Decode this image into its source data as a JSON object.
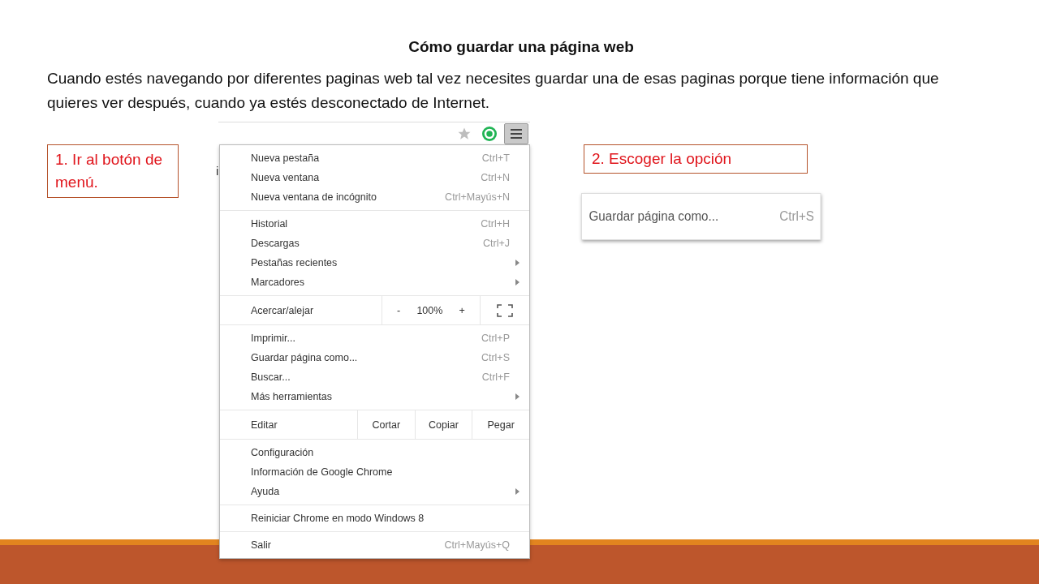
{
  "slide": {
    "title": "Cómo guardar una página web",
    "intro": "Cuando estés navegando por diferentes paginas web tal vez necesites guardar una de esas paginas porque tiene información que quieres ver después, cuando ya estés desconectado de Internet.",
    "step_1": "1. Ir al botón de menú.",
    "step_2": "2. Escoger la opción"
  },
  "browser_screenshot": {
    "page_fragment": "i",
    "sections": [
      {
        "kind": "items",
        "items": [
          {
            "label": "Nueva pestaña",
            "shortcut": "Ctrl+T",
            "submenu": false
          },
          {
            "label": "Nueva ventana",
            "shortcut": "Ctrl+N",
            "submenu": false
          },
          {
            "label": "Nueva ventana de incógnito",
            "shortcut": "Ctrl+Mayús+N",
            "submenu": false
          }
        ]
      },
      {
        "kind": "items",
        "items": [
          {
            "label": "Historial",
            "shortcut": "Ctrl+H",
            "submenu": false
          },
          {
            "label": "Descargas",
            "shortcut": "Ctrl+J",
            "submenu": false
          },
          {
            "label": "Pestañas recientes",
            "submenu": true
          },
          {
            "label": "Marcadores",
            "submenu": true
          }
        ]
      },
      {
        "kind": "zoom",
        "label": "Acercar/alejar",
        "minus": "-",
        "value": "100%",
        "plus": "+"
      },
      {
        "kind": "items",
        "items": [
          {
            "label": "Imprimir...",
            "shortcut": "Ctrl+P",
            "submenu": false
          },
          {
            "label": "Guardar página como...",
            "shortcut": "Ctrl+S",
            "submenu": false
          },
          {
            "label": "Buscar...",
            "shortcut": "Ctrl+F",
            "submenu": false
          },
          {
            "label": "Más herramientas",
            "submenu": true
          }
        ]
      },
      {
        "kind": "edit",
        "label": "Editar",
        "buttons": [
          "Cortar",
          "Copiar",
          "Pegar"
        ]
      },
      {
        "kind": "items",
        "items": [
          {
            "label": "Configuración",
            "submenu": false
          },
          {
            "label": "Información de Google Chrome",
            "submenu": false
          },
          {
            "label": "Ayuda",
            "submenu": true
          }
        ]
      },
      {
        "kind": "items",
        "items": [
          {
            "label": "Reiniciar Chrome en modo Windows 8",
            "submenu": false
          }
        ]
      },
      {
        "kind": "items",
        "items": [
          {
            "label": "Salir",
            "shortcut": "Ctrl+Mayús+Q",
            "submenu": false
          }
        ]
      }
    ]
  },
  "option_snippet": {
    "label": "Guardar página como...",
    "shortcut": "Ctrl+S"
  }
}
